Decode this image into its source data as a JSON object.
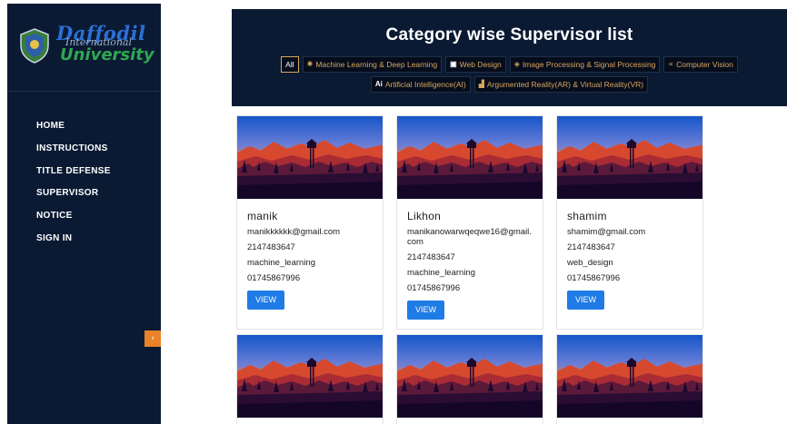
{
  "brand": {
    "line1": "Daffodil",
    "line2": "International",
    "line3": "University"
  },
  "sidebar": {
    "items": [
      {
        "label": "HOME"
      },
      {
        "label": "INSTRUCTIONS"
      },
      {
        "label": "TITLE DEFENSE"
      },
      {
        "label": "SUPERVISOR"
      },
      {
        "label": "NOTICE"
      },
      {
        "label": "SIGN IN"
      }
    ],
    "collapse_glyph": "‹"
  },
  "header": {
    "title": "Category wise Supervisor list",
    "filters": [
      {
        "label": "All",
        "icon": ""
      },
      {
        "label": "Machine Learning & Deep Learning",
        "icon": "gear-icon"
      },
      {
        "label": "Web Design",
        "icon": "window-icon"
      },
      {
        "label": "Image Processing & Signal Processing",
        "icon": "layers-icon"
      },
      {
        "label": "Computer Vision",
        "icon": "share-icon"
      },
      {
        "label": "Artificial Intelligence(AI)",
        "icon": "ai-icon"
      },
      {
        "label": "Argumented Reality(AR) & Virtual Reality(VR)",
        "icon": "chart-icon"
      }
    ]
  },
  "cards": [
    {
      "name": "manik",
      "email": "manikkkkkk@gmail.com",
      "id": "2147483647",
      "category": "machine_learning",
      "phone": "01745867996",
      "button": "VIEW"
    },
    {
      "name": "Likhon",
      "email": "manikanowarwqeqwe16@gmail.com",
      "id": "2147483647",
      "category": "machine_learning",
      "phone": "01745867996",
      "button": "VIEW"
    },
    {
      "name": "shamim",
      "email": "shamim@gmail.com",
      "id": "2147483647",
      "category": "web_design",
      "phone": "01745867996",
      "button": "VIEW"
    }
  ],
  "colors": {
    "navy": "#0b1a33",
    "accent_gold": "#d8a55e",
    "button_blue": "#1f7be5",
    "collapse_orange": "#e8832a"
  }
}
